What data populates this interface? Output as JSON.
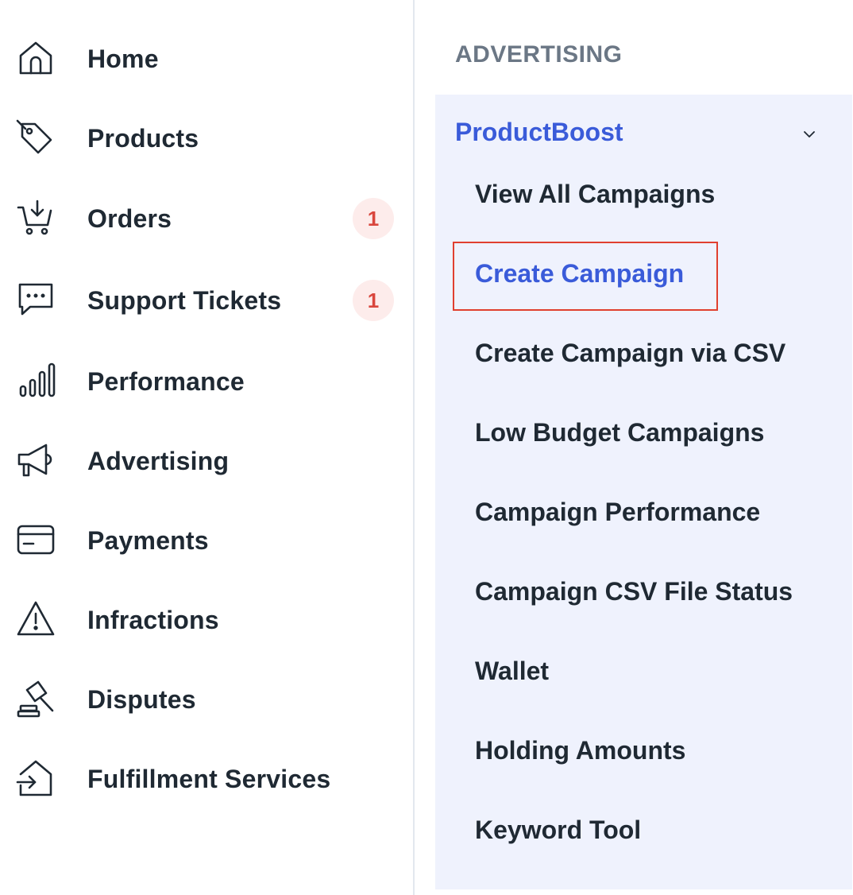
{
  "left_nav": {
    "items": [
      {
        "label": "Home",
        "icon": "home-icon"
      },
      {
        "label": "Products",
        "icon": "tag-icon"
      },
      {
        "label": "Orders",
        "icon": "cart-icon",
        "badge": "1"
      },
      {
        "label": "Support Tickets",
        "icon": "chat-icon",
        "badge": "1"
      },
      {
        "label": "Performance",
        "icon": "bar-chart-icon"
      },
      {
        "label": "Advertising",
        "icon": "megaphone-icon"
      },
      {
        "label": "Payments",
        "icon": "credit-card-icon"
      },
      {
        "label": "Infractions",
        "icon": "warning-icon"
      },
      {
        "label": "Disputes",
        "icon": "gavel-icon"
      },
      {
        "label": "Fulfillment Services",
        "icon": "box-arrow-icon"
      }
    ]
  },
  "submenu": {
    "section_header": "ADVERTISING",
    "group_title": "ProductBoost",
    "items": [
      {
        "label": "View All Campaigns"
      },
      {
        "label": "Create Campaign",
        "active": true
      },
      {
        "label": "Create Campaign via CSV"
      },
      {
        "label": "Low Budget Campaigns"
      },
      {
        "label": "Campaign Performance"
      },
      {
        "label": "Campaign CSV File Status"
      },
      {
        "label": "Wallet"
      },
      {
        "label": "Holding Amounts"
      },
      {
        "label": "Keyword Tool"
      }
    ]
  },
  "colors": {
    "accent": "#3a5bd9",
    "badge_bg": "#fdeceb",
    "badge_text": "#d9463d",
    "panel_bg": "#eff2fd",
    "highlight_border": "#e0402f"
  }
}
